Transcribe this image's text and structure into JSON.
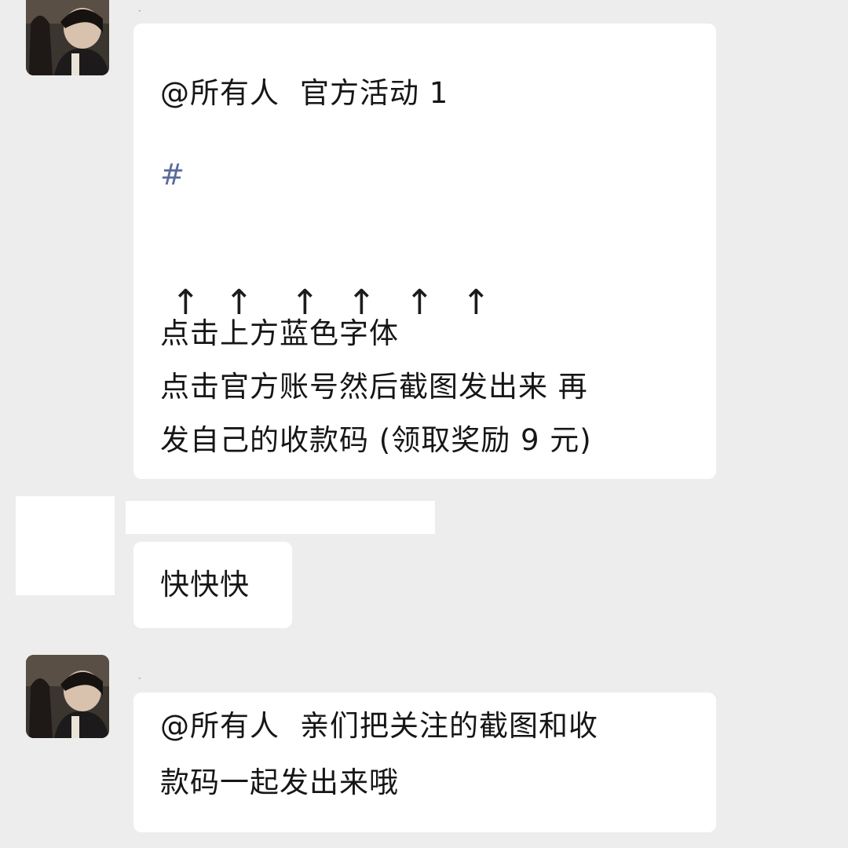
{
  "messages": [
    {
      "sender_marker": "·",
      "mention": "@所有人",
      "title": "官方活动 1",
      "hashtag": "#",
      "arrows": [
        "↑",
        "↑",
        "↑",
        "↑",
        "↑",
        "↑"
      ],
      "lines": [
        "点击上方蓝色字体",
        "点击官方账号然后截图发出来 再",
        "发自己的收款码 (领取奖励 9 元)"
      ]
    },
    {
      "text": "快快快"
    },
    {
      "sender_marker": "·",
      "mention": "@所有人",
      "lines": [
        "亲们把关注的截图和收",
        "款码一起发出来哦"
      ]
    }
  ],
  "colors": {
    "background": "#ededed",
    "bubble": "#ffffff",
    "hashtag": "#5b6b9a"
  },
  "icons": [
    "avatar-photo",
    "avatar-redacted",
    "up-arrow"
  ]
}
